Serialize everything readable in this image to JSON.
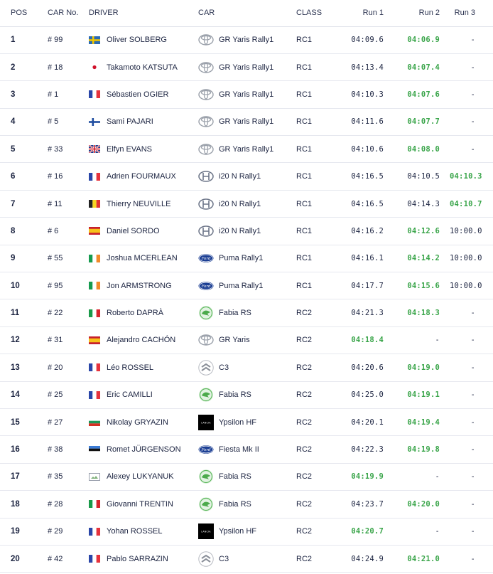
{
  "header": {
    "pos": "POS",
    "car_no": "CAR No.",
    "driver": "DRIVER",
    "car": "CAR",
    "class": "CLASS",
    "run1": "Run 1",
    "run2": "Run 2",
    "run3": "Run 3"
  },
  "colors": {
    "best_time": "#3aa54a",
    "text": "#1b2340",
    "row_border": "#e6e8ef"
  },
  "rows": [
    {
      "pos": "1",
      "car_no": "# 99",
      "flag": "sweden",
      "driver": "Oliver SOLBERG",
      "brand": "toyota",
      "car": "GR Yaris Rally1",
      "class": "RC1",
      "run1": "04:09.6",
      "run2": "04:06.9",
      "run3": "-",
      "best": 2
    },
    {
      "pos": "2",
      "car_no": "# 18",
      "flag": "japan",
      "driver": "Takamoto KATSUTA",
      "brand": "toyota",
      "car": "GR Yaris Rally1",
      "class": "RC1",
      "run1": "04:13.4",
      "run2": "04:07.4",
      "run3": "-",
      "best": 2
    },
    {
      "pos": "3",
      "car_no": "# 1",
      "flag": "france",
      "driver": "Sébastien OGIER",
      "brand": "toyota",
      "car": "GR Yaris Rally1",
      "class": "RC1",
      "run1": "04:10.3",
      "run2": "04:07.6",
      "run3": "-",
      "best": 2
    },
    {
      "pos": "4",
      "car_no": "# 5",
      "flag": "finland",
      "driver": "Sami PAJARI",
      "brand": "toyota",
      "car": "GR Yaris Rally1",
      "class": "RC1",
      "run1": "04:11.6",
      "run2": "04:07.7",
      "run3": "-",
      "best": 2
    },
    {
      "pos": "5",
      "car_no": "# 33",
      "flag": "uk",
      "driver": "Elfyn EVANS",
      "brand": "toyota",
      "car": "GR Yaris Rally1",
      "class": "RC1",
      "run1": "04:10.6",
      "run2": "04:08.0",
      "run3": "-",
      "best": 2
    },
    {
      "pos": "6",
      "car_no": "# 16",
      "flag": "france",
      "driver": "Adrien FOURMAUX",
      "brand": "hyundai",
      "car": "i20 N Rally1",
      "class": "RC1",
      "run1": "04:16.5",
      "run2": "04:10.5",
      "run3": "04:10.3",
      "best": 3
    },
    {
      "pos": "7",
      "car_no": "# 11",
      "flag": "belgium",
      "driver": "Thierry NEUVILLE",
      "brand": "hyundai",
      "car": "i20 N Rally1",
      "class": "RC1",
      "run1": "04:16.5",
      "run2": "04:14.3",
      "run3": "04:10.7",
      "best": 3
    },
    {
      "pos": "8",
      "car_no": "# 6",
      "flag": "spain",
      "driver": "Daniel SORDO",
      "brand": "hyundai",
      "car": "i20 N Rally1",
      "class": "RC1",
      "run1": "04:16.2",
      "run2": "04:12.6",
      "run3": "10:00.0",
      "best": 2
    },
    {
      "pos": "9",
      "car_no": "# 55",
      "flag": "ireland",
      "driver": "Joshua MCERLEAN",
      "brand": "ford",
      "car": "Puma Rally1",
      "class": "RC1",
      "run1": "04:16.1",
      "run2": "04:14.2",
      "run3": "10:00.0",
      "best": 2
    },
    {
      "pos": "10",
      "car_no": "# 95",
      "flag": "ireland",
      "driver": "Jon ARMSTRONG",
      "brand": "ford",
      "car": "Puma Rally1",
      "class": "RC1",
      "run1": "04:17.7",
      "run2": "04:15.6",
      "run3": "10:00.0",
      "best": 2
    },
    {
      "pos": "11",
      "car_no": "# 22",
      "flag": "italy",
      "driver": "Roberto DAPRÀ",
      "brand": "skoda",
      "car": "Fabia RS",
      "class": "RC2",
      "run1": "04:21.3",
      "run2": "04:18.3",
      "run3": "-",
      "best": 2
    },
    {
      "pos": "12",
      "car_no": "# 31",
      "flag": "spain",
      "driver": "Alejandro CACHÓN",
      "brand": "toyota",
      "car": "GR Yaris",
      "class": "RC2",
      "run1": "04:18.4",
      "run2": "-",
      "run3": "-",
      "best": 1
    },
    {
      "pos": "13",
      "car_no": "# 20",
      "flag": "france",
      "driver": "Léo ROSSEL",
      "brand": "citroen",
      "car": "C3",
      "class": "RC2",
      "run1": "04:20.6",
      "run2": "04:19.0",
      "run3": "-",
      "best": 2
    },
    {
      "pos": "14",
      "car_no": "# 25",
      "flag": "france",
      "driver": "Eric CAMILLI",
      "brand": "skoda",
      "car": "Fabia RS",
      "class": "RC2",
      "run1": "04:25.0",
      "run2": "04:19.1",
      "run3": "-",
      "best": 2
    },
    {
      "pos": "15",
      "car_no": "# 27",
      "flag": "bulgaria",
      "driver": "Nikolay GRYAZIN",
      "brand": "lancia",
      "car": "Ypsilon HF",
      "class": "RC2",
      "run1": "04:20.1",
      "run2": "04:19.4",
      "run3": "-",
      "best": 2
    },
    {
      "pos": "16",
      "car_no": "# 38",
      "flag": "estonia",
      "driver": "Romet JÜRGENSON",
      "brand": "ford",
      "car": "Fiesta Mk II",
      "class": "RC2",
      "run1": "04:22.3",
      "run2": "04:19.8",
      "run3": "-",
      "best": 2
    },
    {
      "pos": "17",
      "car_no": "# 35",
      "flag": "missing",
      "driver": "Alexey LUKYANUK",
      "brand": "skoda",
      "car": "Fabia RS",
      "class": "RC2",
      "run1": "04:19.9",
      "run2": "-",
      "run3": "-",
      "best": 1
    },
    {
      "pos": "18",
      "car_no": "# 28",
      "flag": "italy",
      "driver": "Giovanni TRENTIN",
      "brand": "skoda",
      "car": "Fabia RS",
      "class": "RC2",
      "run1": "04:23.7",
      "run2": "04:20.0",
      "run3": "-",
      "best": 2
    },
    {
      "pos": "19",
      "car_no": "# 29",
      "flag": "france",
      "driver": "Yohan ROSSEL",
      "brand": "lancia",
      "car": "Ypsilon HF",
      "class": "RC2",
      "run1": "04:20.7",
      "run2": "-",
      "run3": "-",
      "best": 1
    },
    {
      "pos": "20",
      "car_no": "# 42",
      "flag": "france",
      "driver": "Pablo SARRAZIN",
      "brand": "citroen",
      "car": "C3",
      "class": "RC2",
      "run1": "04:24.9",
      "run2": "04:21.0",
      "run3": "-",
      "best": 2
    }
  ]
}
